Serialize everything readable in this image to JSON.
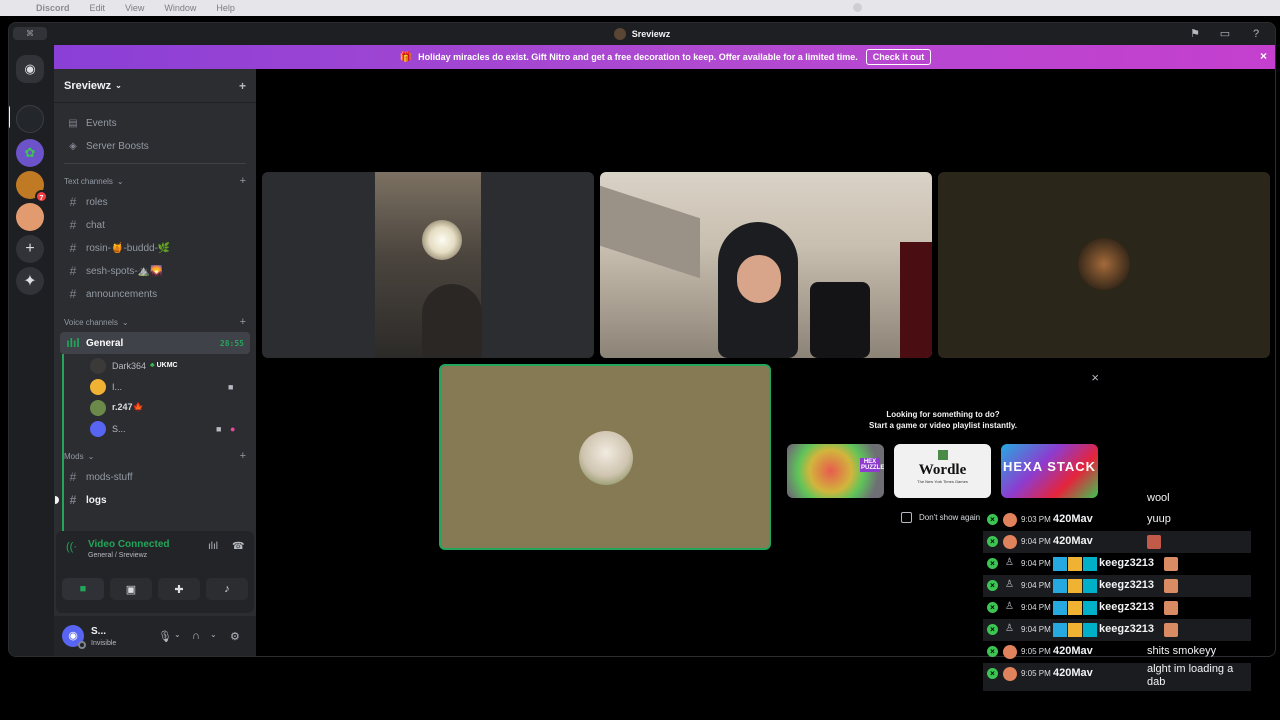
{
  "menubar": {
    "apple": "",
    "app": "Discord",
    "items": [
      "Edit",
      "View",
      "Window",
      "Help"
    ]
  },
  "titlebar": {
    "title": "Sreviewz",
    "search": "⌘"
  },
  "banner": {
    "text": "Holiday miracles do exist. Gift Nitro and get a free decoration to keep. Offer available for a limited time.",
    "cta": "Check it out"
  },
  "server": {
    "name": "Sreviewz"
  },
  "nav": {
    "events": "Events",
    "boosts": "Server Boosts"
  },
  "categories": {
    "text": "Text channels",
    "voice": "Voice channels",
    "mods": "Mods"
  },
  "text_channels": [
    "roles",
    "chat",
    "rosin-🍯-buddd-🌿",
    "sesh-spots-⛰️🌄",
    "announcements"
  ],
  "voice_channel": {
    "name": "General",
    "timer": "28:55"
  },
  "voice_users": [
    {
      "name": "Dark364",
      "tag": "UKMC"
    },
    {
      "name": "I..."
    },
    {
      "name": "r.247🍁"
    },
    {
      "name": "S..."
    }
  ],
  "mods_channels": [
    "mods-stuff",
    "logs"
  ],
  "voice_panel": {
    "status": "Video Connected",
    "location": "General / Sreviewz"
  },
  "user_panel": {
    "name": "S...",
    "status": "Invisible"
  },
  "activity": {
    "line1": "Looking for something to do?",
    "line2": "Start a game or video playlist instantly.",
    "games": [
      "HEX PUZZLE",
      "Wordle",
      "HEXA STACK"
    ],
    "wordle_sub": "The New York Times Games",
    "checkbox": "Don't show again"
  },
  "chat": [
    {
      "time": "",
      "user": "",
      "msg": "wool"
    },
    {
      "time": "9:03 PM",
      "user": "420Mav",
      "msg": "yuup"
    },
    {
      "time": "9:04 PM",
      "user": "420Mav",
      "msg": ""
    },
    {
      "time": "9:04 PM",
      "user": "keegz3213",
      "msg": ""
    },
    {
      "time": "9:04 PM",
      "user": "keegz3213",
      "msg": ""
    },
    {
      "time": "9:04 PM",
      "user": "keegz3213",
      "msg": ""
    },
    {
      "time": "9:04 PM",
      "user": "keegz3213",
      "msg": ""
    },
    {
      "time": "9:05 PM",
      "user": "420Mav",
      "msg": "shits smokeyy"
    },
    {
      "time": "9:05 PM",
      "user": "420Mav",
      "msg": "alght im loading a dab"
    }
  ],
  "colors": {
    "green": "#23a55a",
    "blurple": "#5865f2",
    "nitro": "#b14ad0"
  }
}
